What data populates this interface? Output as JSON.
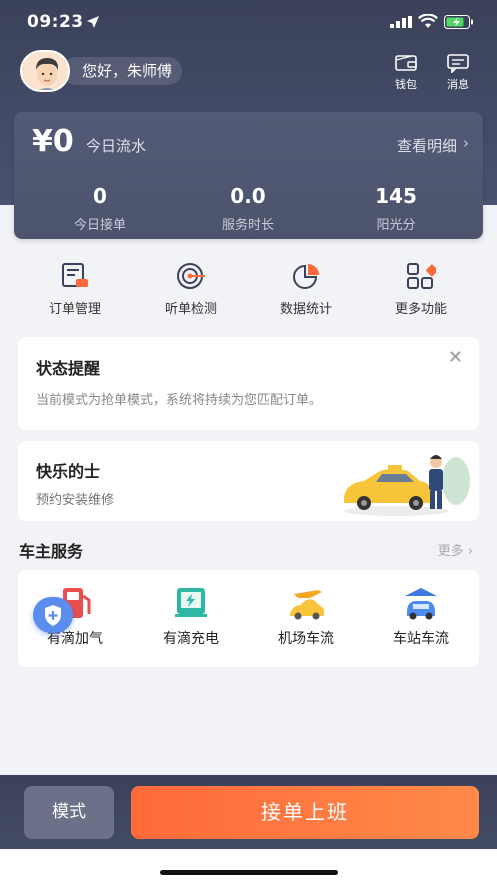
{
  "status_bar": {
    "time": "09:23"
  },
  "greeting": {
    "text": "您好，朱师傅"
  },
  "top_actions": [
    {
      "label": "钱包",
      "icon": "wallet-icon"
    },
    {
      "label": "消息",
      "icon": "message-icon"
    }
  ],
  "earnings": {
    "amount": "¥0",
    "label": "今日流水",
    "detail_link": "查看明细",
    "stats": [
      {
        "value": "0",
        "label": "今日接单"
      },
      {
        "value": "0.0",
        "label": "服务时长"
      },
      {
        "value": "145",
        "label": "阳光分"
      }
    ]
  },
  "quick_actions": [
    {
      "label": "订单管理",
      "icon": "order-icon"
    },
    {
      "label": "听单检测",
      "icon": "target-icon"
    },
    {
      "label": "数据统计",
      "icon": "pie-chart-icon"
    },
    {
      "label": "更多功能",
      "icon": "grid-icon"
    }
  ],
  "notice": {
    "title": "状态提醒",
    "text": "当前模式为抢单模式，系统将持续为您匹配订单。"
  },
  "promo": {
    "title": "快乐的士",
    "subtitle": "预约安装维修"
  },
  "services_section": {
    "title": "车主服务",
    "more": "更多",
    "items": [
      {
        "label": "有滴加气",
        "icon": "gas-pump-icon"
      },
      {
        "label": "有滴充电",
        "icon": "charging-icon"
      },
      {
        "label": "机场车流",
        "icon": "airport-icon"
      },
      {
        "label": "车站车流",
        "icon": "station-icon"
      }
    ]
  },
  "bottom_bar": {
    "mode_label": "模式",
    "go_label": "接单上班"
  },
  "colors": {
    "header": "#3a4159",
    "accent": "#ff6a3a",
    "blue": "#5b8dee"
  }
}
